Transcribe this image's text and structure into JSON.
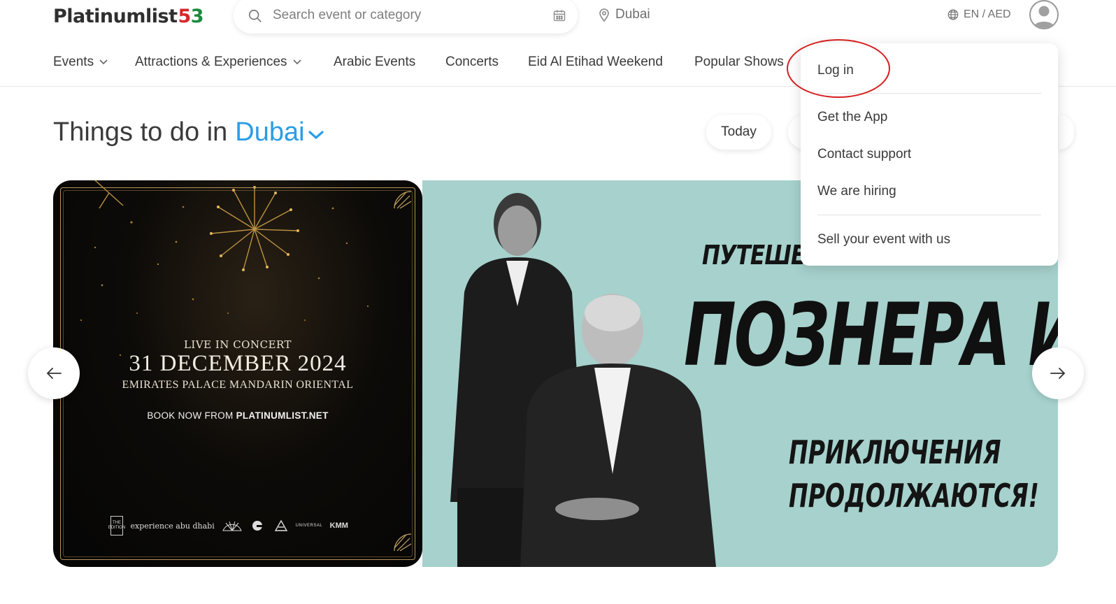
{
  "header": {
    "logo_text": "Platinumlist",
    "logo_badge_5": "5",
    "logo_badge_3": "3",
    "search_placeholder": "Search event or category",
    "location": "Dubai",
    "language_currency": "EN / AED"
  },
  "nav": {
    "items": [
      {
        "label": "Events",
        "has_dropdown": true
      },
      {
        "label": "Attractions & Experiences",
        "has_dropdown": true
      },
      {
        "label": "Arabic Events",
        "has_dropdown": false
      },
      {
        "label": "Concerts",
        "has_dropdown": false
      },
      {
        "label": "Eid Al Etihad Weekend",
        "has_dropdown": false
      },
      {
        "label": "Popular Shows",
        "has_dropdown": false
      }
    ]
  },
  "main": {
    "title_prefix": "Things to do in",
    "title_city": "Dubai",
    "filter_chips": [
      "Today"
    ]
  },
  "banners": [
    {
      "line1": "LIVE IN CONCERT",
      "line2": "31 DECEMBER 2024",
      "line3": "EMIRATES PALACE MANDARIN ORIENTAL",
      "line4_prefix": "BOOK NOW FROM",
      "line4_site": "PLATINUMLIST.NET",
      "sponsors": [
        "THE EDITION",
        "experience abu dhabi",
        "MANDARIN",
        "UNIVERSAL",
        "KMM"
      ]
    },
    {
      "line1": "ПУТЕШЕСТВИЯ",
      "line2": "ПОЗНЕРА И",
      "line3": "ПРИКЛЮЧЕНИЯ",
      "line4": "ПРОДОЛЖАЮТСЯ!"
    }
  ],
  "user_menu": {
    "items": [
      "Log in",
      "Get the App",
      "Contact support",
      "We are hiring",
      "Sell your event with us"
    ]
  },
  "colors": {
    "accent": "#2a9de6",
    "annotation": "#d61f1f",
    "banner2_bg": "#a6d1cc"
  }
}
